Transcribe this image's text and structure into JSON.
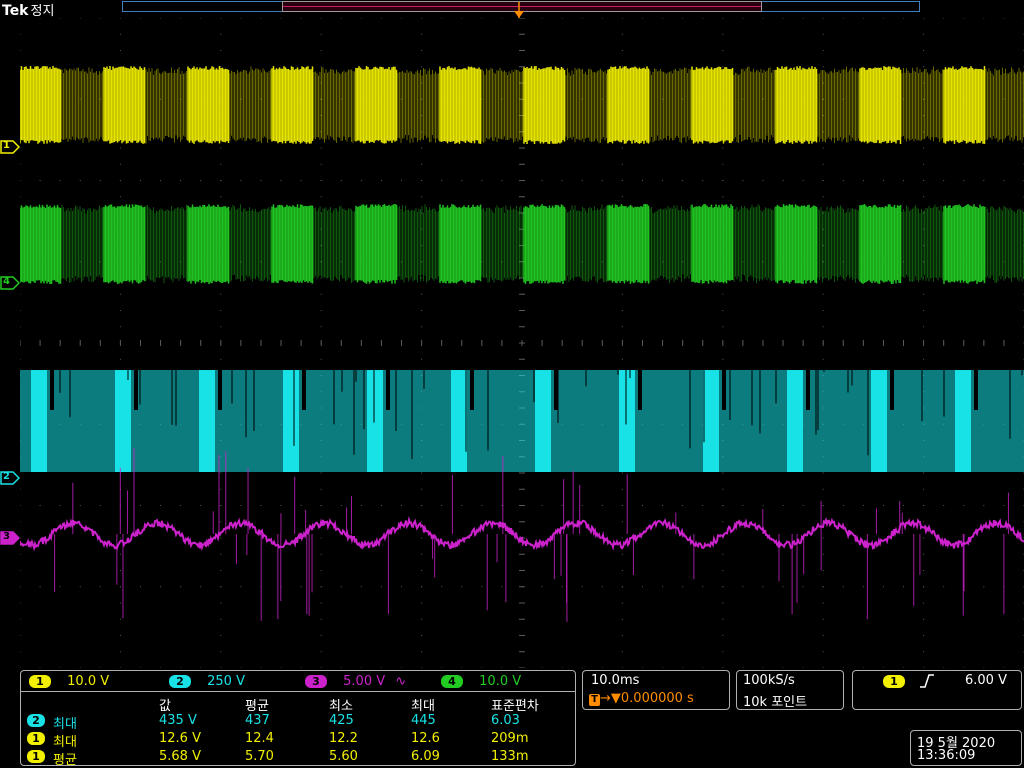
{
  "header": {
    "brand": "Tek",
    "status": "정지"
  },
  "colors": {
    "ch1": "#f2f000",
    "ch2": "#18e2e6",
    "ch3": "#cc22cc",
    "ch4": "#22cc22",
    "trigger": "#ff8c00",
    "grid": "#5a5a5a",
    "record": "#3f7fbf"
  },
  "channels": [
    {
      "id": "1",
      "scale": "10.0 V",
      "color": "#f2f000",
      "coupling": ""
    },
    {
      "id": "2",
      "scale": "250 V",
      "color": "#18e2e6",
      "coupling": ""
    },
    {
      "id": "3",
      "scale": "5.00 V",
      "color": "#cc22cc",
      "coupling": "∿"
    },
    {
      "id": "4",
      "scale": "10.0 V",
      "color": "#22cc22",
      "coupling": ""
    }
  ],
  "markers": {
    "ch1": "1",
    "ch2": "2",
    "ch3": "3",
    "ch4": "4",
    "trigger": "T"
  },
  "timebase": {
    "scale": "10.0ms",
    "trigger_delay": "0.000000 s",
    "sample_rate": "100kS/s",
    "record_length": "10k 포인트"
  },
  "trigger": {
    "source": "1",
    "slope_icon": "rising-edge-icon",
    "level": "6.00 V"
  },
  "measurements": {
    "headers": [
      "값",
      "평균",
      "최소",
      "최대",
      "표준편차"
    ],
    "rows": [
      {
        "channel": "2",
        "name": "최대",
        "value": "435 V",
        "mean": "437",
        "min": "425",
        "max": "445",
        "stddev": "6.03",
        "color": "#18e2e6"
      },
      {
        "channel": "1",
        "name": "최대",
        "value": "12.6 V",
        "mean": "12.4",
        "min": "12.2",
        "max": "12.6",
        "stddev": "209m",
        "color": "#f2f000"
      },
      {
        "channel": "1",
        "name": "평균",
        "value": "5.68 V",
        "mean": "5.70",
        "min": "5.60",
        "max": "6.09",
        "stddev": "133m",
        "color": "#f2f000"
      }
    ]
  },
  "datetime": {
    "date": "19 5월 2020",
    "time": "13:36:09"
  }
}
